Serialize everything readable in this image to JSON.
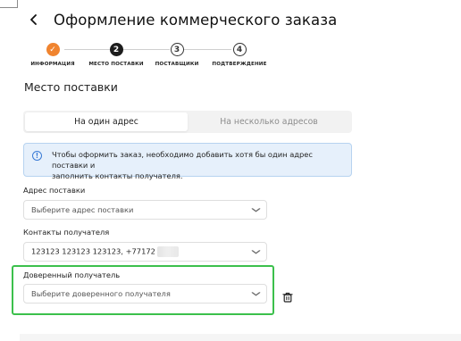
{
  "header": {
    "back_icon": "chevron-left-icon",
    "title": "Оформление коммерческого заказа"
  },
  "stepper": {
    "steps": [
      {
        "label": "ИНФОРМАЦИЯ",
        "marker": "✓",
        "state": "done"
      },
      {
        "label": "МЕСТО ПОСТАВКИ",
        "marker": "2",
        "state": "active"
      },
      {
        "label": "ПОСТАВЩИКИ",
        "marker": "3",
        "state": "todo"
      },
      {
        "label": "ПОДТВЕРЖДЕНИЕ",
        "marker": "4",
        "state": "todo"
      }
    ],
    "done_color": "#f0842f"
  },
  "section_title": "Место поставки",
  "address_mode": {
    "tabs": [
      "На один адрес",
      "На несколько адресов"
    ],
    "selected": "На один адрес"
  },
  "info": {
    "icon": "info-circle-icon",
    "line1": "Чтобы оформить заказ, необходимо добавить хотя бы один адрес поставки и",
    "line2": "заполнить контакты получателя."
  },
  "fields": {
    "address": {
      "label": "Адрес поставки",
      "placeholder": "Выберите адрес поставки"
    },
    "contacts": {
      "label": "Контакты получателя",
      "value": "123123 123123 123123, +77172"
    },
    "trusted": {
      "label": "Доверенный получатель",
      "placeholder": "Выберите доверенного получателя"
    }
  },
  "highlight_color": "#3cc04c",
  "delete_icon": "trash-icon"
}
